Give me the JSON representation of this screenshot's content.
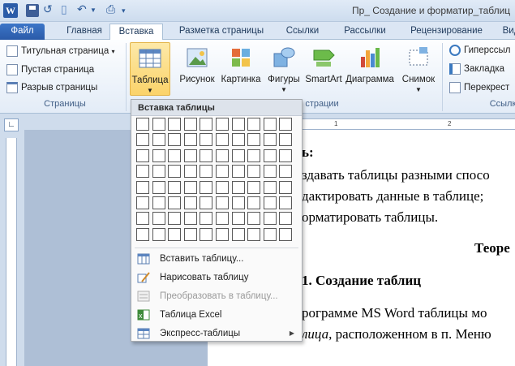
{
  "window": {
    "title": "Пр_ Создание и форматир_таблиц"
  },
  "tabs": [
    {
      "label": "Файл"
    },
    {
      "label": "Главная"
    },
    {
      "label": "Вставка"
    },
    {
      "label": "Разметка страницы"
    },
    {
      "label": "Ссылки"
    },
    {
      "label": "Рассылки"
    },
    {
      "label": "Рецензирование"
    },
    {
      "label": "Вид"
    }
  ],
  "ribbon": {
    "pages_group": {
      "label": "Страницы",
      "cover_page": "Титульная страница",
      "blank_page": "Пустая страница",
      "page_break": "Разрыв страницы"
    },
    "table_button": "Таблица",
    "picture": "Рисунок",
    "clipart": "Картинка",
    "shapes": "Фигуры",
    "smartart": "SmartArt",
    "chart": "Диаграмма",
    "screenshot": "Снимок",
    "illustrations_label": "страции",
    "links_group": {
      "hyperlink": "Гиперссыл",
      "bookmark": "Закладка",
      "crossref": "Перекрест",
      "label": "Ссылк"
    }
  },
  "dropdown": {
    "header": "Вставка таблицы",
    "items": [
      {
        "label": "Вставить таблицу...",
        "icon": "insert-table-icon"
      },
      {
        "label": "Нарисовать таблицу",
        "icon": "draw-table-icon"
      },
      {
        "label": "Преобразовать в таблицу...",
        "icon": "convert-table-icon"
      },
      {
        "label": "Таблица Excel",
        "icon": "excel-icon"
      },
      {
        "label": "Экспресс-таблицы",
        "icon": "quick-tables-icon"
      }
    ]
  },
  "ruler": {
    "numbers": [
      "1",
      "2"
    ]
  },
  "document": {
    "line1": "ь:",
    "line2": "здавать таблицы разными спосо",
    "line3": "дактировать данные в таблице;",
    "line4": "орматировать таблицы.",
    "line5": "Теоре",
    "line6": "1.  Создание таблиц",
    "line7": "рограмме MS Word таблицы мо",
    "line8_italic": "лица",
    "line8_rest": ", расположенном в п. Меню"
  },
  "colors": {
    "accent": "#2a5aa8",
    "highlight": "#fbd36a"
  }
}
